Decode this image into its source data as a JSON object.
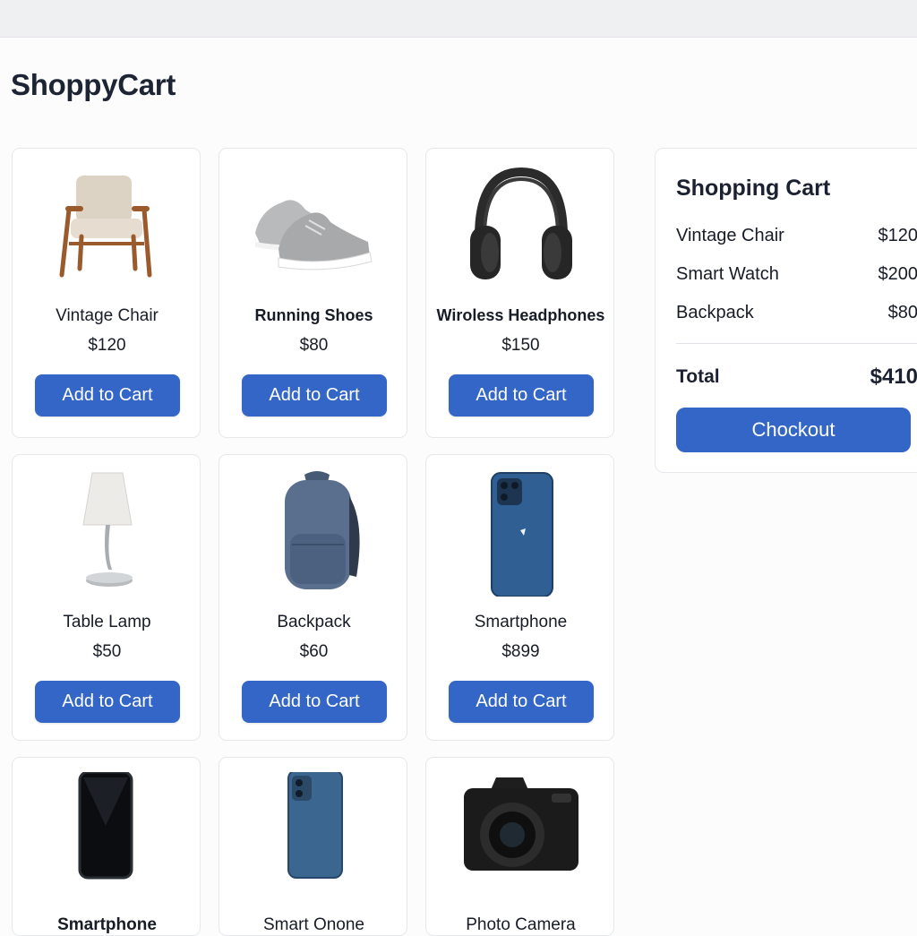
{
  "app": {
    "title": "ShoppyCart"
  },
  "products": [
    {
      "name": "Vintage Chair",
      "price": "$120",
      "button": "Add to Cart",
      "icon": "chair-image"
    },
    {
      "name": "Running Shoes",
      "price": "$80",
      "button": "Add to Cart",
      "icon": "shoes-image"
    },
    {
      "name": "Wiroless Headphones",
      "price": "$150",
      "button": "Add to Cart",
      "icon": "headphones-image"
    },
    {
      "name": "Table Lamp",
      "price": "$50",
      "button": "Add to Cart",
      "icon": "lamp-image"
    },
    {
      "name": "Backpack",
      "price": "$60",
      "button": "Add to Cart",
      "icon": "backpack-image"
    },
    {
      "name": "Smartphone",
      "price": "$899",
      "button": "Add to Cart",
      "icon": "smartphone-image"
    },
    {
      "name": "Smartphone",
      "icon": "black-smartphone-image"
    },
    {
      "name": "Smart Onone",
      "icon": "blue-smartphone-image"
    },
    {
      "name": "Photo Camera",
      "icon": "camera-image"
    }
  ],
  "cart": {
    "title": "Shopping Cart",
    "items": [
      {
        "name": "Vintage Chair",
        "price": "$120"
      },
      {
        "name": "Smart Watch",
        "price": "$200"
      },
      {
        "name": "Backpack",
        "price": "$80"
      }
    ],
    "total_label": "Total",
    "total_value": "$410",
    "checkout_label": "Chockout"
  },
  "colors": {
    "accent": "#3366c6",
    "background": "#fcfcfd",
    "topbar": "#eff0f2"
  }
}
